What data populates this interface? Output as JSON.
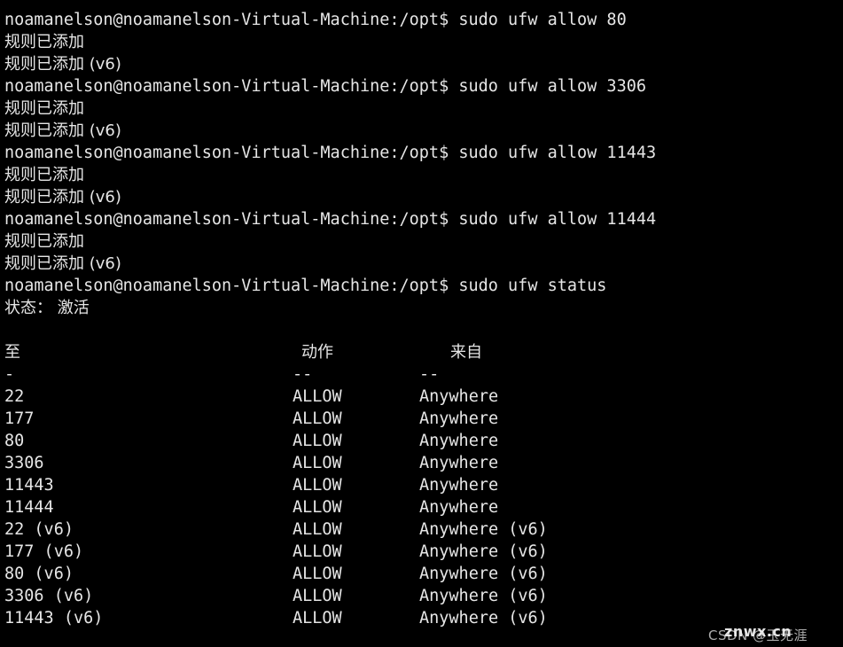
{
  "terminal": {
    "prompt": "noamanelson@noamanelson-Virtual-Machine:/opt$",
    "colors": {
      "background": "#000000",
      "foreground": "#e6e6e6"
    },
    "lines": [
      {
        "type": "command",
        "prompt": "noamanelson@noamanelson-Virtual-Machine:/opt$",
        "command": " sudo ufw allow 80"
      },
      {
        "type": "output",
        "text": "规则已添加"
      },
      {
        "type": "output",
        "text": "规则已添加 (v6)"
      },
      {
        "type": "command",
        "prompt": "noamanelson@noamanelson-Virtual-Machine:/opt$",
        "command": " sudo ufw allow 3306"
      },
      {
        "type": "output",
        "text": "规则已添加"
      },
      {
        "type": "output",
        "text": "规则已添加 (v6)"
      },
      {
        "type": "command",
        "prompt": "noamanelson@noamanelson-Virtual-Machine:/opt$",
        "command": " sudo ufw allow 11443"
      },
      {
        "type": "output",
        "text": "规则已添加"
      },
      {
        "type": "output",
        "text": "规则已添加 (v6)"
      },
      {
        "type": "command",
        "prompt": "noamanelson@noamanelson-Virtual-Machine:/opt$",
        "command": " sudo ufw allow 11444"
      },
      {
        "type": "output",
        "text": "规则已添加"
      },
      {
        "type": "output",
        "text": "规则已添加 (v6)"
      },
      {
        "type": "command",
        "prompt": "noamanelson@noamanelson-Virtual-Machine:/opt$",
        "command": " sudo ufw status"
      },
      {
        "type": "output",
        "text": "状态： 激活"
      },
      {
        "type": "blank",
        "text": ""
      }
    ],
    "status_table": {
      "headers": {
        "to": "至",
        "action": "动作",
        "from": "来自"
      },
      "separators": {
        "to": "-",
        "action": "--",
        "from": "--"
      },
      "rows": [
        {
          "to": "22",
          "action": "ALLOW",
          "from": "Anywhere"
        },
        {
          "to": "177",
          "action": "ALLOW",
          "from": "Anywhere"
        },
        {
          "to": "80",
          "action": "ALLOW",
          "from": "Anywhere"
        },
        {
          "to": "3306",
          "action": "ALLOW",
          "from": "Anywhere"
        },
        {
          "to": "11443",
          "action": "ALLOW",
          "from": "Anywhere"
        },
        {
          "to": "11444",
          "action": "ALLOW",
          "from": "Anywhere"
        },
        {
          "to": "22 (v6)",
          "action": "ALLOW",
          "from": "Anywhere (v6)"
        },
        {
          "to": "177 (v6)",
          "action": "ALLOW",
          "from": "Anywhere (v6)"
        },
        {
          "to": "80 (v6)",
          "action": "ALLOW",
          "from": "Anywhere (v6)"
        },
        {
          "to": "3306 (v6)",
          "action": "ALLOW",
          "from": "Anywhere (v6)"
        },
        {
          "to": "11443 (v6)",
          "action": "ALLOW",
          "from": "Anywhere (v6)"
        }
      ]
    },
    "watermark": {
      "back": "CSDN @玉无涯",
      "front": "znwx.cn"
    }
  }
}
